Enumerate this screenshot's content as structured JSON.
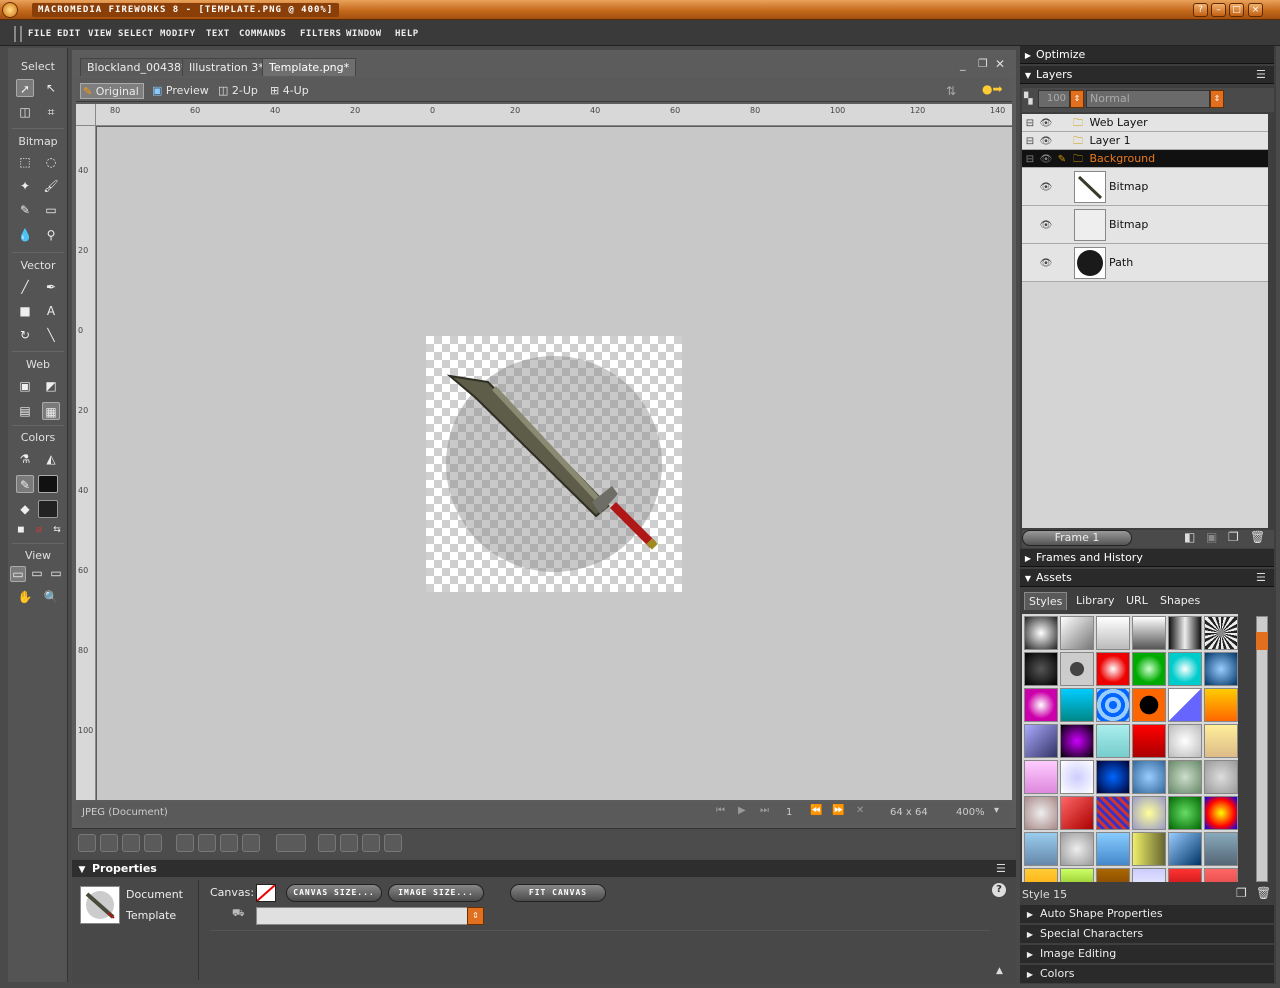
{
  "window": {
    "title": "MACROMEDIA FIREWORKS 8 - [TEMPLATE.PNG @ 400%]"
  },
  "menu": [
    "FILE",
    "EDIT",
    "VIEW",
    "SELECT",
    "MODIFY",
    "TEXT",
    "COMMANDS",
    "FILTERS",
    "WINDOW",
    "HELP"
  ],
  "tools": {
    "sections": [
      "Select",
      "Bitmap",
      "Vector",
      "Web",
      "Colors",
      "View"
    ]
  },
  "document": {
    "tabs": [
      {
        "label": "Blockland_00438*",
        "active": false
      },
      {
        "label": "Illustration 3*",
        "active": false
      },
      {
        "label": "Template.png*",
        "active": true
      }
    ],
    "views": [
      "Original",
      "Preview",
      "2-Up",
      "4-Up"
    ],
    "ruler_top": [
      "80",
      "60",
      "40",
      "20",
      "0",
      "20",
      "40",
      "60",
      "80",
      "100",
      "120",
      "140"
    ],
    "ruler_left": [
      "40",
      "20",
      "0",
      "20",
      "40",
      "60",
      "80",
      "100"
    ],
    "status_left": "JPEG (Document)",
    "frame_number": "1",
    "size": "64 x 64",
    "zoom": "400%"
  },
  "properties": {
    "title": "Properties",
    "doc_label": "Document",
    "doc_name": "Template",
    "canvas_label": "Canvas:",
    "buttons": [
      "CANVAS SIZE...",
      "IMAGE SIZE...",
      "FIT CANVAS"
    ]
  },
  "panels": {
    "optimize": "Optimize",
    "layers": "Layers",
    "opacity": "100",
    "blend": "Normal",
    "layer_list": [
      {
        "name": "Web Layer",
        "type": "folder"
      },
      {
        "name": "Layer 1",
        "type": "folder"
      },
      {
        "name": "Background",
        "type": "folder",
        "selected": true
      },
      {
        "name": "Bitmap",
        "type": "object"
      },
      {
        "name": "Bitmap",
        "type": "object"
      },
      {
        "name": "Path",
        "type": "object"
      }
    ],
    "frame": "Frame 1",
    "frames_history": "Frames and History",
    "assets": "Assets",
    "asset_tabs": [
      "Styles",
      "Library",
      "URL",
      "Shapes"
    ],
    "style_name": "Style 15",
    "collapsed": [
      "Auto Shape Properties",
      "Special Characters",
      "Image Editing",
      "Colors"
    ]
  },
  "colors": {
    "accent": "#e07020",
    "canvas_bg": "#c8c8c8",
    "panel": "#3e3e3e"
  }
}
